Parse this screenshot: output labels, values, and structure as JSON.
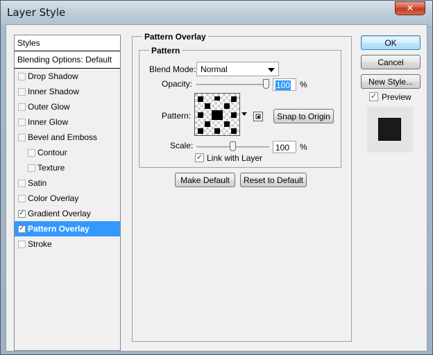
{
  "window": {
    "title": "Layer Style",
    "close_glyph": "✕"
  },
  "styles": {
    "header": "Styles",
    "blending_options": "Blending Options: Default",
    "items": [
      {
        "label": "Drop Shadow",
        "checked": false,
        "sub": false,
        "selected": false
      },
      {
        "label": "Inner Shadow",
        "checked": false,
        "sub": false,
        "selected": false
      },
      {
        "label": "Outer Glow",
        "checked": false,
        "sub": false,
        "selected": false
      },
      {
        "label": "Inner Glow",
        "checked": false,
        "sub": false,
        "selected": false
      },
      {
        "label": "Bevel and Emboss",
        "checked": false,
        "sub": false,
        "selected": false
      },
      {
        "label": "Contour",
        "checked": false,
        "sub": true,
        "selected": false
      },
      {
        "label": "Texture",
        "checked": false,
        "sub": true,
        "selected": false
      },
      {
        "label": "Satin",
        "checked": false,
        "sub": false,
        "selected": false
      },
      {
        "label": "Color Overlay",
        "checked": false,
        "sub": false,
        "selected": false
      },
      {
        "label": "Gradient Overlay",
        "checked": true,
        "sub": false,
        "selected": false
      },
      {
        "label": "Pattern Overlay",
        "checked": true,
        "sub": false,
        "selected": true
      },
      {
        "label": "Stroke",
        "checked": false,
        "sub": false,
        "selected": false
      }
    ]
  },
  "panel": {
    "title": "Pattern Overlay",
    "group_title": "Pattern",
    "blend_mode_label": "Blend Mode:",
    "blend_mode_value": "Normal",
    "opacity_label": "Opacity:",
    "opacity_value": "100",
    "opacity_unit": "%",
    "opacity_level": 1.0,
    "pattern_label": "Pattern:",
    "snap_label": "Snap to Origin",
    "scale_label": "Scale:",
    "scale_value": "100",
    "scale_unit": "%",
    "scale_level": 0.5,
    "link_label": "Link with Layer",
    "link_checked": true,
    "make_default_label": "Make Default",
    "reset_default_label": "Reset to Default"
  },
  "actions": {
    "ok_label": "OK",
    "cancel_label": "Cancel",
    "new_style_label": "New Style...",
    "preview_label": "Preview",
    "preview_checked": true
  },
  "colors": {
    "selection": "#3399ff",
    "check": "#1a3a8a"
  }
}
